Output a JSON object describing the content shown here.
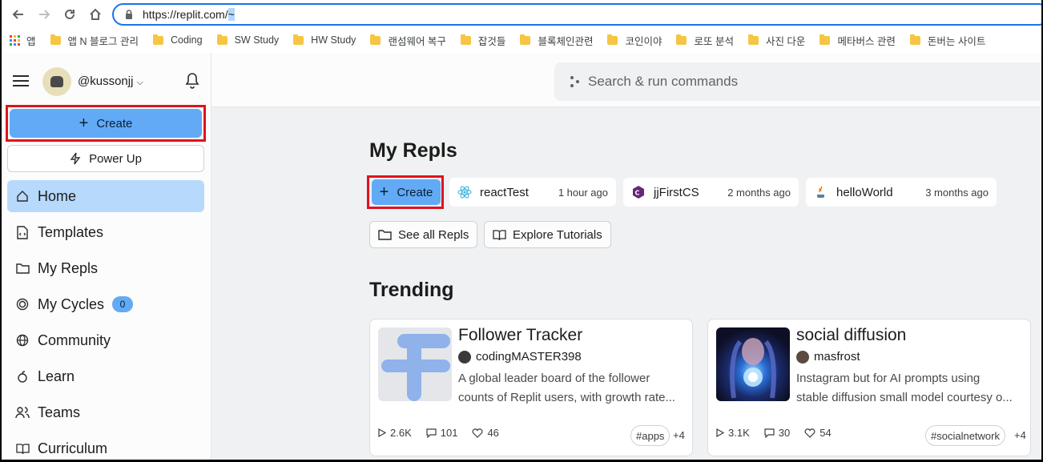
{
  "browser": {
    "url_main": "https://replit.com/",
    "url_selected": "~",
    "bookmarks": [
      "앱",
      "앱 N 블로그 관리",
      "Coding",
      "SW Study",
      "HW Study",
      "랜섬웨어 복구",
      "잡것들",
      "블록체인관련",
      "코인이야",
      "로또 분석",
      "사진 다운",
      "메타버스 관련",
      "돈버는 사이트"
    ]
  },
  "search": {
    "placeholder": "Search & run commands"
  },
  "sidebar": {
    "username": "@kussonjj",
    "create_label": "Create",
    "powerup_label": "Power Up",
    "items": [
      {
        "label": "Home",
        "icon": "home-icon"
      },
      {
        "label": "Templates",
        "icon": "templates-icon"
      },
      {
        "label": "My Repls",
        "icon": "folder-icon"
      },
      {
        "label": "My Cycles",
        "icon": "cycles-icon",
        "badge": "0"
      },
      {
        "label": "Community",
        "icon": "globe-icon"
      },
      {
        "label": "Learn",
        "icon": "learn-icon"
      },
      {
        "label": "Teams",
        "icon": "teams-icon"
      },
      {
        "label": "Curriculum",
        "icon": "book-icon"
      }
    ]
  },
  "main": {
    "my_repls_title": "My Repls",
    "create_label": "Create",
    "repls": [
      {
        "name": "reactTest",
        "time": "1 hour ago",
        "icon": "react-icon"
      },
      {
        "name": "jjFirstCS",
        "time": "2 months ago",
        "icon": "csharp-icon"
      },
      {
        "name": "helloWorld",
        "time": "3 months ago",
        "icon": "java-icon"
      }
    ],
    "see_all_label": "See all Repls",
    "explore_label": "Explore Tutorials",
    "trending_title": "Trending",
    "trending": [
      {
        "title": "Follower Tracker",
        "author": "codingMASTER398",
        "desc_line1": "A global leader board of the follower",
        "desc_line2": "counts of Replit users, with growth rate...",
        "runs": "2.6K",
        "comments": "101",
        "likes": "46",
        "tag": "#apps",
        "more": "+4"
      },
      {
        "title": "social diffusion",
        "author": "masfrost",
        "desc_line1": "Instagram but for AI prompts using",
        "desc_line2": "stable diffusion small model courtesy o...",
        "runs": "3.1K",
        "comments": "30",
        "likes": "54",
        "tag": "#socialnetwork",
        "more": "+4"
      }
    ]
  },
  "colors": {
    "accent": "#62aaf6",
    "active": "#b7d9fc",
    "highlight_box": "#e0121e"
  }
}
